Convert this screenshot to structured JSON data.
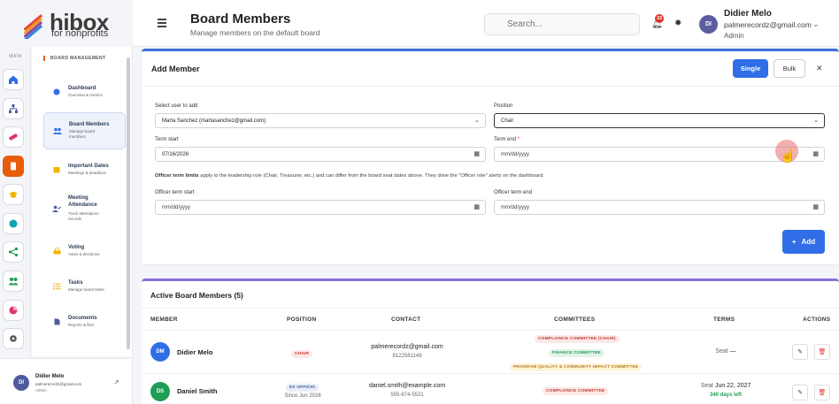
{
  "app": {
    "logo_word": "hibox",
    "logo_sub": "for nonprofits"
  },
  "rail": {
    "section_label": "MAIN"
  },
  "submenu": {
    "title": "BOARD MANAGEMENT",
    "items": [
      {
        "label": "Dashboard",
        "desc": "Overview & metrics"
      },
      {
        "label": "Board Members",
        "desc": "Manage board members"
      },
      {
        "label": "Important Dates",
        "desc": "Meetings & deadlines"
      },
      {
        "label": "Meeting Attendance",
        "desc": "Track attendance records"
      },
      {
        "label": "Voting",
        "desc": "Votes & decisions"
      },
      {
        "label": "Tasks",
        "desc": "Manage board tasks"
      },
      {
        "label": "Documents",
        "desc": "Reports & files"
      }
    ]
  },
  "sidebar_user": {
    "initials": "DI",
    "name": "Didier Melo",
    "email": "palmerecordz@gmail.com",
    "role": "Admin"
  },
  "header": {
    "title": "Board Members",
    "subtitle": "Manage members on the default board",
    "search_placeholder": "Search...",
    "notification_count": "33",
    "user": {
      "initials": "DI",
      "name": "Didier Melo",
      "email": "palmerecordz@gmail.com",
      "role": "Admin"
    }
  },
  "add_member": {
    "title": "Add Member",
    "single_label": "Single",
    "bulk_label": "Bulk",
    "select_user_label": "Select user to add",
    "select_user_value": "Marta Sanchez (martasanchez@gmail.com)",
    "position_label": "Position",
    "position_value": "Chair",
    "term_start_label": "Term start",
    "term_start_value": "07/16/2026",
    "term_end_label": "Term end",
    "term_end_required": "*",
    "term_end_value": "mm/dd/yyyy",
    "note_bold": "Officer term limits",
    "note_text": " apply to the leadership role (Chair, Treasurer, etc.) and can differ from the board seat dates above. They drive the \"Officer role\" alerts on the dashboard.",
    "officer_start_label": "Officer term start",
    "officer_start_value": "mm/dd/yyyy",
    "officer_end_label": "Officer term end",
    "officer_end_value": "mm/dd/yyyy",
    "add_label": "Add"
  },
  "members_table": {
    "title": "Active Board Members (5)",
    "columns": [
      "MEMBER",
      "POSITION",
      "CONTACT",
      "COMMITTEES",
      "TERMS",
      "ACTIONS"
    ],
    "rows": [
      {
        "initials": "DM",
        "name": "Didier Melo",
        "position": "CHAIR",
        "position_sub": "",
        "email": "palmerecordz@gmail.com",
        "phone": "8122581149",
        "committees": [
          "COMPLIANCE COMMITTEE (CHAIR)",
          "FINANCE COMMITTEE",
          "PROGRAM QUALITY & COMMUNITY IMPACT COMMITTEE"
        ],
        "term_prefix": "Seat",
        "term_value": "—",
        "term_note": ""
      },
      {
        "initials": "DS",
        "name": "Daniel Smith",
        "position": "EX OFFICIO",
        "position_sub": "Since Jun 2026",
        "email": "daniel.smith@example.com",
        "phone": "555-874-5521",
        "committees": [
          "COMPLIANCE COMMITTEE"
        ],
        "term_prefix": "Seat",
        "term_value": "Jun 22, 2027",
        "term_note": "340 days left"
      }
    ]
  },
  "colors": {
    "accent_blue": "#2f6ee6",
    "accent_orange": "#e85d0c",
    "danger": "#d9342b",
    "success": "#1f9d55"
  }
}
